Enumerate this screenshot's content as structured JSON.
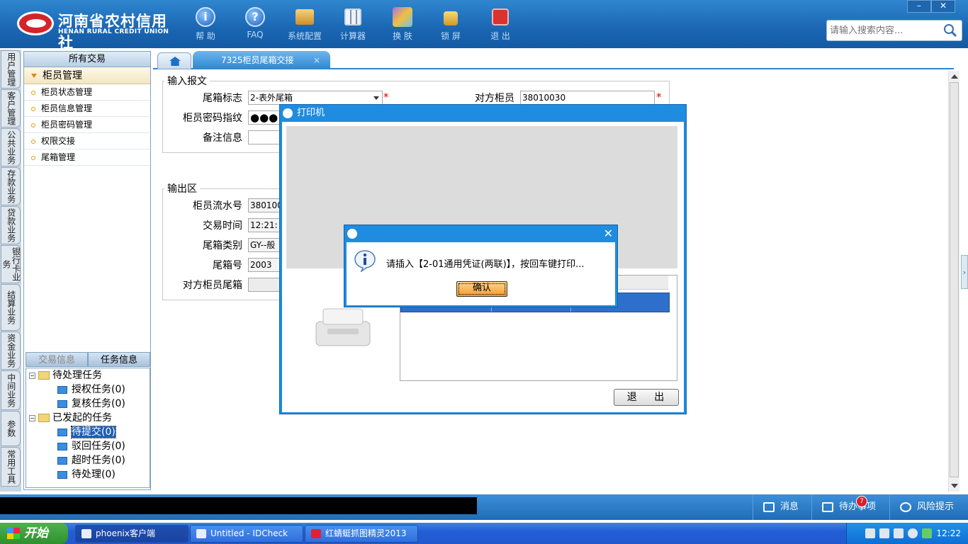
{
  "header": {
    "logo_cn": "河南省农村信用社",
    "logo_en": "HENAN RURAL CREDIT UNION",
    "toolbar": [
      {
        "label": "帮 助",
        "icon": "info-icon"
      },
      {
        "label": "FAQ",
        "icon": "help-icon"
      },
      {
        "label": "系统配置",
        "icon": "toolbox-icon"
      },
      {
        "label": "计算器",
        "icon": "calculator-icon"
      },
      {
        "label": "换 肤",
        "icon": "shirt-icon"
      },
      {
        "label": "锁 屏",
        "icon": "lock-icon"
      },
      {
        "label": "退 出",
        "icon": "power-icon"
      }
    ],
    "search_placeholder": "请输入搜索内容...",
    "window_min": "–",
    "window_close": "✕"
  },
  "rail": [
    "用户管理",
    "客户管理",
    "公共业务",
    "存款业务",
    "贷款业务",
    "银行卡业务",
    "结算业务",
    "资金业务",
    "中间业务",
    "参数",
    "常用工具"
  ],
  "sidebar": {
    "header": "所有交易",
    "group": "柜员管理",
    "items": [
      "柜员状态管理",
      "柜员信息管理",
      "柜员密码管理",
      "权限交接",
      "尾箱管理"
    ],
    "tabs": [
      "交易信息",
      "任务信息"
    ],
    "tree": {
      "pending": "待处理任务",
      "pending_children": [
        "授权任务(0)",
        "复核任务(0)"
      ],
      "initiated": "已发起的任务",
      "initiated_children": [
        "待提交(0)",
        "驳回任务(0)",
        "超时任务(0)",
        "待处理(0)"
      ]
    }
  },
  "tabs": {
    "active": "7325柜员尾箱交接",
    "close": "×"
  },
  "form": {
    "input_legend": "输入报文",
    "box_flag_label": "尾箱标志",
    "box_flag_value": "2-表外尾箱",
    "counter_teller_label": "对方柜员",
    "counter_teller_value": "38010030",
    "pwd_label": "柜员密码指纹",
    "pwd_value": "●●●",
    "remark_label": "备注信息",
    "required_mark": "*",
    "output_legend": "输出区",
    "serial_label": "柜员流水号",
    "serial_value": "380100",
    "time_label": "交易时间",
    "time_value": "12:21:",
    "type_label": "尾箱类别",
    "type_value": "GY--般",
    "boxno_label": "尾箱号",
    "boxno_value": "2003",
    "counter_box_label": "对方柜员尾箱"
  },
  "printer_window": {
    "title": "打印机",
    "exit_button": "退 出"
  },
  "message_dialog": {
    "text": "请插入【2-01通用凭证(两联)】，按回车键打印...",
    "ok": "确认",
    "close": "✕"
  },
  "statusbar": {
    "messages": "消息",
    "todo": "待办事项",
    "todo_badge": "7",
    "risk": "风险提示"
  },
  "taskbar": {
    "start": "开始",
    "tasks": [
      "phoenix客户端",
      "Untitled - IDCheck",
      "红蜻蜓抓图精灵2013"
    ],
    "clock": "12:22"
  },
  "colors": {
    "header_blue": "#1a66b3",
    "window_blue": "#1f8ce0",
    "ok_orange": "#f29d2a"
  }
}
